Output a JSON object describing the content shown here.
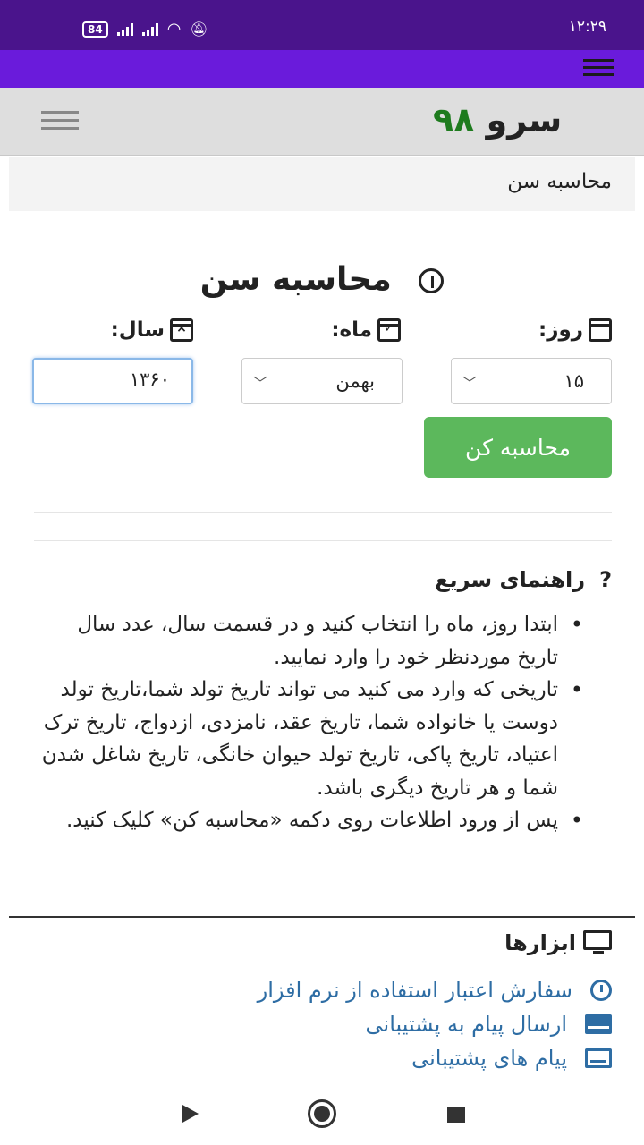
{
  "status": {
    "time": "۱۲:۲۹",
    "battery": "84"
  },
  "header": {
    "brand_word": "سرو",
    "brand_num": "۹۸"
  },
  "breadcrumb": "محاسبه سن",
  "page_title": "محاسبه سن",
  "form": {
    "day_label": "روز:",
    "month_label": "ماه:",
    "year_label": "سال:",
    "day_value": "۱۵",
    "month_value": "بهمن",
    "year_value": "۱۳۶۰",
    "submit": "محاسبه کن"
  },
  "guide": {
    "title": "راهنمای سریع",
    "items": [
      "ابتدا روز، ماه را انتخاب کنید و در قسمت سال، عدد سال تاریخ موردنظر خود را وارد نمایید.",
      "تاریخی که وارد می کنید می تواند تاریخ تولد شما،تاریخ تولد دوست یا خانواده شما، تاریخ عقد، نامزدی، ازدواج، تاریخ ترک اعتیاد، تاریخ پاکی، تاریخ تولد حیوان خانگی، تاریخ شاغل شدن شما و هر تاریخ دیگری باشد.",
      "پس از ورود اطلاعات روی دکمه «محاسبه کن» کلیک کنید."
    ]
  },
  "tools": {
    "title": "ابزارها",
    "links": [
      {
        "label": "سفارش اعتبار استفاده از نرم افزار",
        "icon": "clock-icon"
      },
      {
        "label": "ارسال پیام به پشتیبانی",
        "icon": "envelope-icon"
      },
      {
        "label": "پیام های پشتیبانی",
        "icon": "envelope-outline-icon"
      }
    ]
  },
  "colors": {
    "statusbar": "#4a148c",
    "appbar": "#6a1bdb",
    "primary_button": "#5cb85c",
    "link": "#2e6da4",
    "brand_number": "#1e7b1e"
  }
}
